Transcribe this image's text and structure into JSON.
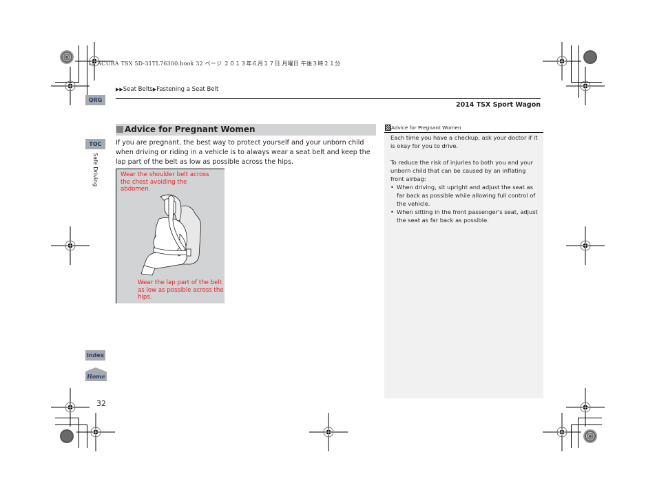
{
  "print_info": {
    "job_line": "14 ACURA TSX 5D-31TL76300.book  32 ページ  ２０１３年６月１７日  月曜日  午後３時２１分"
  },
  "header": {
    "breadcrumb": [
      {
        "label": "Seat Belts"
      },
      {
        "label": "Fastening a Seat Belt"
      }
    ],
    "breadcrumb_glyph": "▶",
    "breadcrumb_lead": "▶▶",
    "model": "2014 TSX Sport Wagon"
  },
  "nav_tabs": {
    "qrg": "QRG",
    "toc": "TOC",
    "index": "Index",
    "home": "Home"
  },
  "chapter_label": "Safe Driving",
  "page_number": "32",
  "section": {
    "title": "Advice for Pregnant Women",
    "body": "If you are pregnant, the best way to protect yourself and your unborn child when driving or riding in a vehicle is to always wear a seat belt and keep the lap part of the belt as low as possible across the hips."
  },
  "illustration": {
    "subject": "pregnant-woman-seated-with-seat-belt",
    "callout_top": "Wear the shoulder belt across the chest avoiding the abdomen.",
    "callout_bottom": "Wear the lap part of the belt as low as possible across the hips."
  },
  "sidebar": {
    "title": "Advice for Pregnant Women",
    "para1": "Each time you have a checkup, ask your doctor if it is okay for you to drive.",
    "para2": "To reduce the risk of injuries to both you and your unborn child that can be caused by an inflating front airbag:",
    "bullets": [
      "When driving, sit upright and adjust the seat as far back as possible while allowing full control of the vehicle.",
      "When sitting in the front passenger's seat, adjust the seat as far back as possible."
    ],
    "bullet_glyph": "•"
  },
  "colors": {
    "callout_red": "#ed1c24",
    "tab_gray": "#a7a9ac",
    "tab_text_blue": "#1c3f6e",
    "heading_bar": "#d1d3d4",
    "sidebar_bg": "#f1f1f2"
  }
}
